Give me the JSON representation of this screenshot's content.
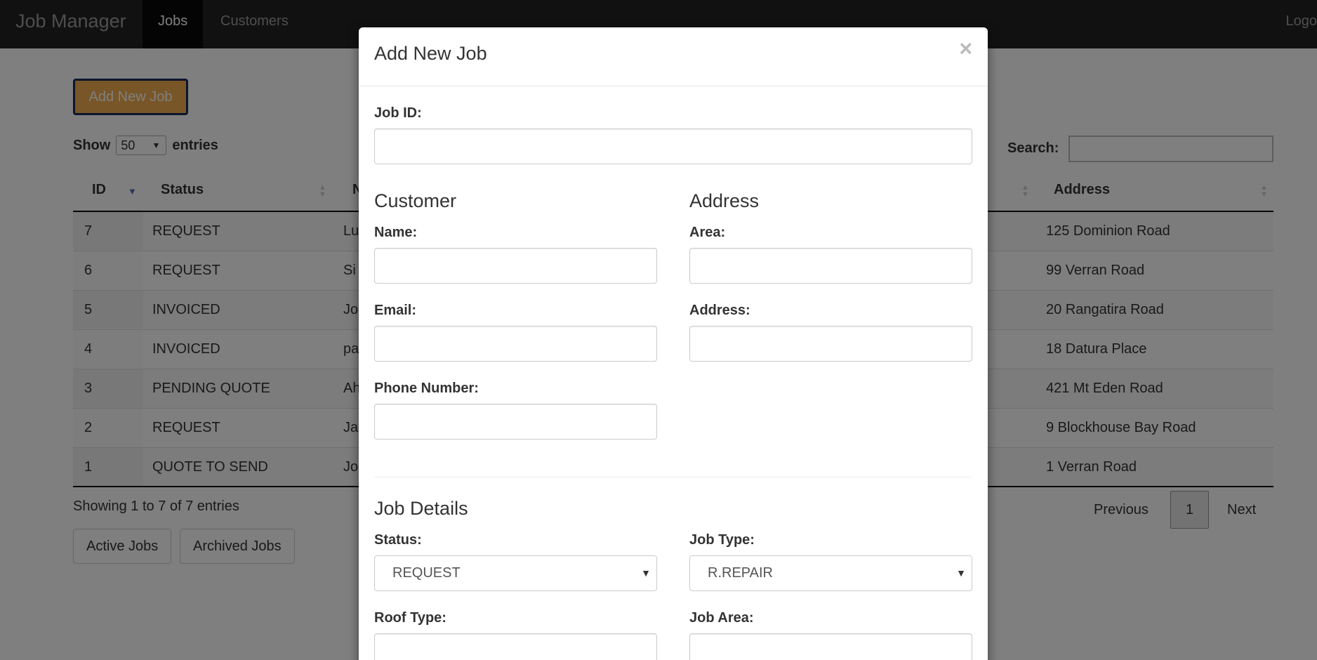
{
  "navbar": {
    "brand": "Job Manager",
    "items": [
      "Jobs",
      "Customers"
    ],
    "logout": "Logo"
  },
  "page": {
    "add_button": "Add New Job",
    "show_label": "Show",
    "entries_value": "50",
    "entries_label": "entries",
    "search_label": "Search:",
    "columns": {
      "id": "ID",
      "status": "Status",
      "name": "N",
      "address": "Address"
    },
    "rows": [
      {
        "id": "7",
        "status": "REQUEST",
        "name": "Lu",
        "address": "125 Dominion Road"
      },
      {
        "id": "6",
        "status": "REQUEST",
        "name": "Si",
        "address": "99 Verran Road"
      },
      {
        "id": "5",
        "status": "INVOICED",
        "name": "Jo",
        "address": "20 Rangatira Road"
      },
      {
        "id": "4",
        "status": "INVOICED",
        "name": "pa",
        "address": "18 Datura Place"
      },
      {
        "id": "3",
        "status": "PENDING QUOTE",
        "name": "Ah",
        "address": "421 Mt Eden Road"
      },
      {
        "id": "2",
        "status": "REQUEST",
        "name": "Ja",
        "address": "9 Blockhouse Bay Road"
      },
      {
        "id": "1",
        "status": "QUOTE TO SEND",
        "name": "Jo",
        "address": "1 Verran Road"
      }
    ],
    "info": "Showing 1 to 7 of 7 entries",
    "pagination": {
      "previous": "Previous",
      "current": "1",
      "next": "Next"
    },
    "active_jobs": "Active Jobs",
    "archived_jobs": "Archived Jobs"
  },
  "modal": {
    "title": "Add New Job",
    "close": "×",
    "job_id_label": "Job ID:",
    "customer_heading": "Customer",
    "address_heading": "Address",
    "name_label": "Name:",
    "area_label": "Area:",
    "email_label": "Email:",
    "address_label": "Address:",
    "phone_label": "Phone Number:",
    "job_details_heading": "Job Details",
    "status_label": "Status:",
    "status_value": "REQUEST",
    "job_type_label": "Job Type:",
    "job_type_value": "R.REPAIR",
    "roof_type_label": "Roof Type:",
    "job_area_label": "Job Area:"
  },
  "colors": {
    "navbar": "#222222",
    "add_button": "#f0ad4e",
    "sort_active": "#337ab7"
  }
}
